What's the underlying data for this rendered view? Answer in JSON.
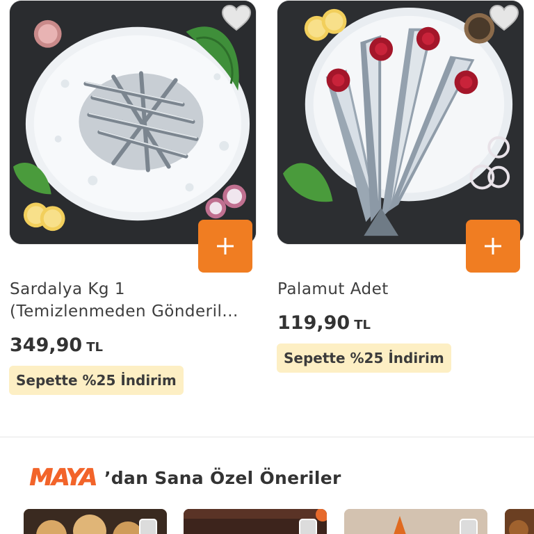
{
  "products": [
    {
      "title_line1": "Sardalya Kg 1",
      "title_line2": "(Temizlenmeden Gönderil...",
      "price": "349,90",
      "currency": "TL",
      "promo": "Sepette %25 İndirim",
      "image_icon": "sardine-on-ice-image",
      "favorite_icon": "heart-icon",
      "add_icon": "plus-icon"
    },
    {
      "title_line1": "Palamut Adet",
      "title_line2": "",
      "price": "119,90",
      "currency": "TL",
      "promo": "Sepette %25 İndirim",
      "image_icon": "bonito-on-ice-image",
      "favorite_icon": "heart-icon",
      "add_icon": "plus-icon"
    }
  ],
  "recommendations": {
    "brand_logo": "MAYA",
    "title": "’dan Sana Özel Öneriler"
  },
  "colors": {
    "accent": "#f07d22",
    "promo_bg": "#fdefc4",
    "brand": "#f2642a"
  }
}
